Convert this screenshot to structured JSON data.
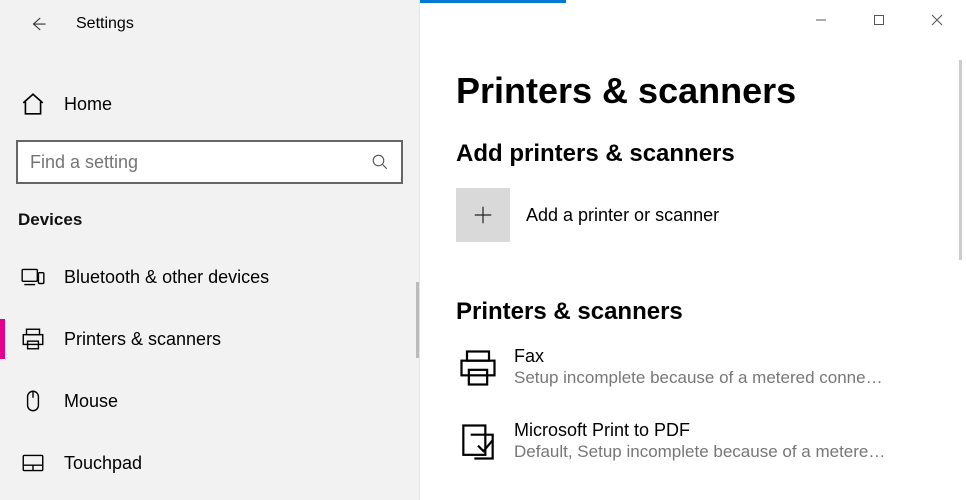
{
  "app_title": "Settings",
  "sidebar": {
    "home_label": "Home",
    "search_placeholder": "Find a setting",
    "group_header": "Devices",
    "items": [
      {
        "label": "Bluetooth & other devices"
      },
      {
        "label": "Printers & scanners"
      },
      {
        "label": "Mouse"
      },
      {
        "label": "Touchpad"
      }
    ]
  },
  "main": {
    "page_title": "Printers & scanners",
    "add_section_title": "Add printers & scanners",
    "add_label": "Add a printer or scanner",
    "list_section_title": "Printers & scanners",
    "devices": [
      {
        "name": "Fax",
        "sub": "Setup incomplete because of a metered conne…"
      },
      {
        "name": "Microsoft Print to PDF",
        "sub": "Default, Setup incomplete because of a metere…"
      }
    ]
  }
}
